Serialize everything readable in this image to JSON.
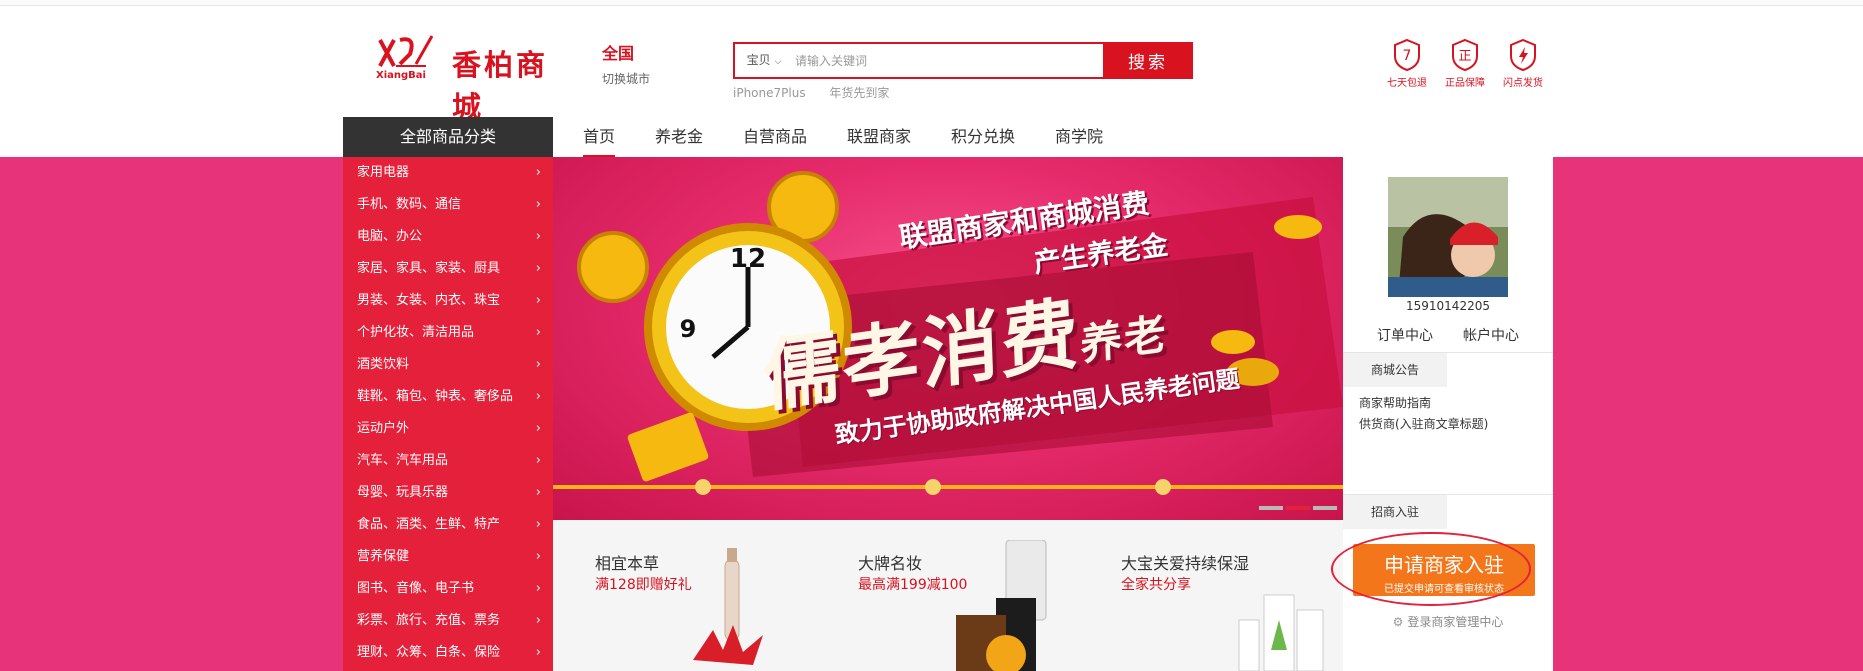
{
  "header": {
    "logo_text": "香柏商城",
    "logo_sub": "XiangBai",
    "city": "全国",
    "city_switch": "切换城市",
    "search": {
      "type": "宝贝",
      "placeholder": "请输入关键词",
      "button": "搜索",
      "hot": [
        "iPhone7Plus",
        "年货先到家"
      ]
    },
    "badges": [
      {
        "icon": "seven-day-return-icon",
        "glyph": "7",
        "label": "七天包退"
      },
      {
        "icon": "genuine-icon",
        "glyph": "正",
        "label": "正品保障"
      },
      {
        "icon": "lightning-icon",
        "glyph": "⚡",
        "label": "闪点发货"
      }
    ]
  },
  "nav": {
    "categories_title": "全部商品分类",
    "items": [
      "首页",
      "养老金",
      "自营商品",
      "联盟商家",
      "积分兑换",
      "商学院"
    ]
  },
  "categories": [
    "家用电器",
    "手机、数码、通信",
    "电脑、办公",
    "家居、家具、家装、厨具",
    "男装、女装、内衣、珠宝",
    "个护化妆、清洁用品",
    "酒类饮料",
    "鞋靴、箱包、钟表、奢侈品",
    "运动户外",
    "汽车、汽车用品",
    "母婴、玩具乐器",
    "食品、酒类、生鲜、特产",
    "营养保健",
    "图书、音像、电子书",
    "彩票、旅行、充值、票务",
    "理财、众筹、白条、保险"
  ],
  "banner": {
    "line1": "联盟商家和商城消费",
    "line2": "产生养老金",
    "main": "儒孝消费",
    "main_small": "养老",
    "sub": "致力于协助政府解决中国人民养老问题"
  },
  "promos": [
    {
      "title": "相宜本草",
      "sub": "满128即赠好礼"
    },
    {
      "title": "大牌名妆",
      "sub": "最高满199减100"
    },
    {
      "title": "大宝关爱持续保湿",
      "sub": "全家共分享"
    }
  ],
  "user_panel": {
    "phone": "15910142205",
    "order_center": "订单中心",
    "account_center": "帐户中心",
    "notice_title": "商城公告",
    "notices": [
      "商家帮助指南",
      "供货商(入驻商文章标题)"
    ],
    "merchant_title": "招商入驻",
    "apply_title": "申请商家入驻",
    "apply_sub": "已提交申请可查看审核状态",
    "login_merchant": "登录商家管理中心"
  },
  "colors": {
    "brand_red": "#d8121e",
    "pink": "#e6337a",
    "orange": "#f3761a"
  }
}
